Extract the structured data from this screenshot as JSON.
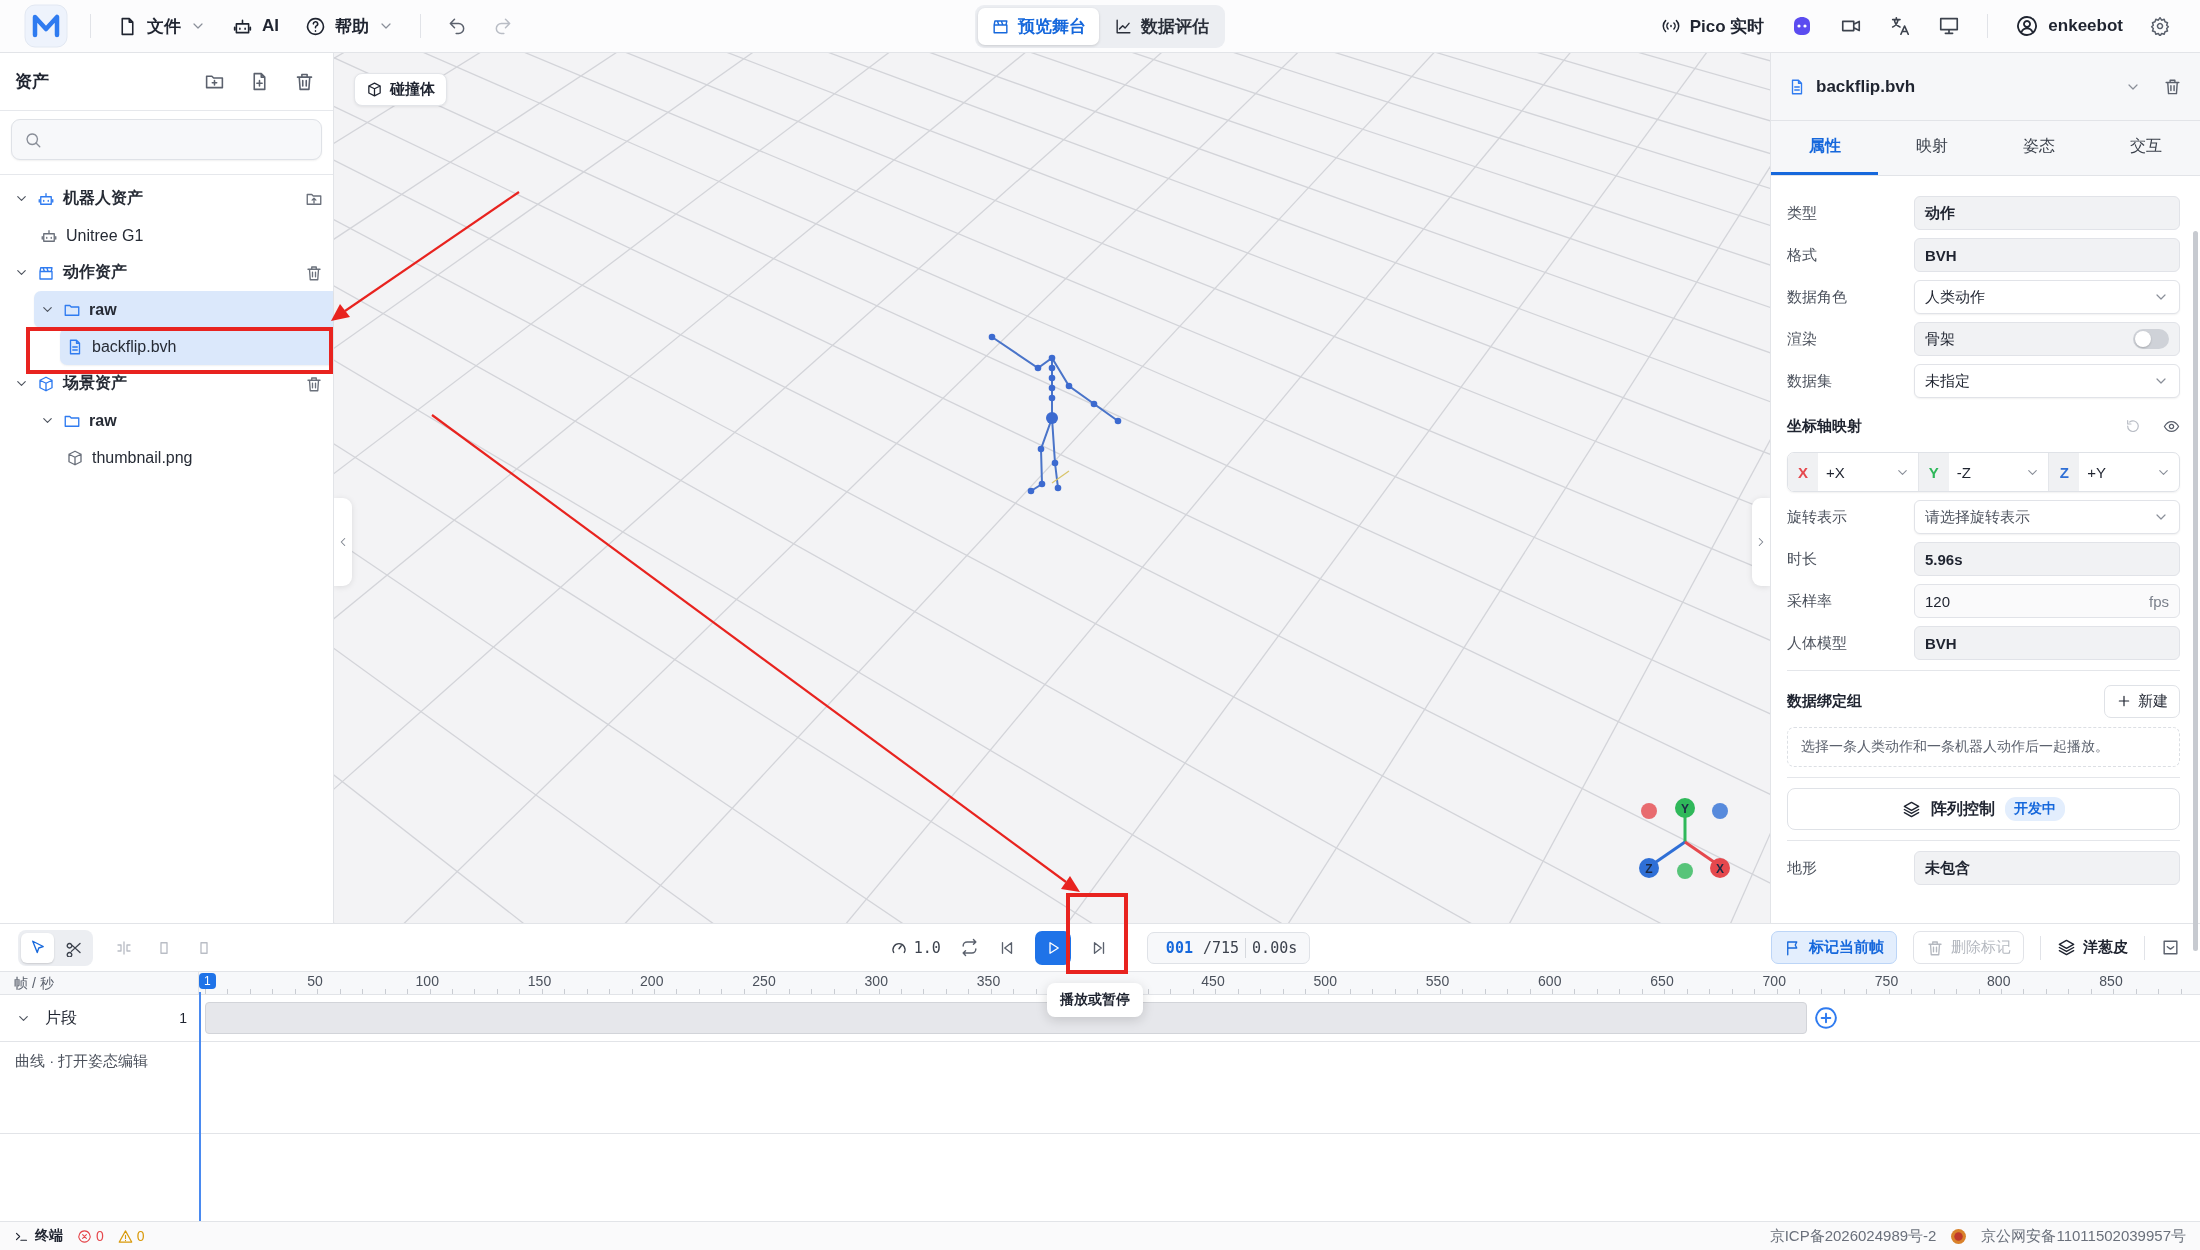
{
  "topbar": {
    "menus": [
      {
        "kind": "file",
        "label": "文件",
        "dropdown": true
      },
      {
        "kind": "ai",
        "label": "AI",
        "dropdown": false
      },
      {
        "kind": "help",
        "label": "帮助",
        "dropdown": true
      }
    ],
    "mode_tabs": [
      {
        "kind": "stage",
        "label": "预览舞台",
        "selected": true
      },
      {
        "kind": "eval",
        "label": "数据评估",
        "selected": false
      }
    ],
    "live": "Pico 实时",
    "user": "enkeebot"
  },
  "assets": {
    "title": "资产",
    "tree": [
      {
        "kind": "robots",
        "label": "机器人资产",
        "expanded": true,
        "selected": false,
        "children": [
          {
            "kind": "robot",
            "label": "Unitree G1",
            "selected": false
          }
        ]
      },
      {
        "kind": "motions",
        "label": "动作资产",
        "expanded": true,
        "selected": false,
        "children": [
          {
            "kind": "folder",
            "label": "raw",
            "expanded": true,
            "selected": true,
            "children": [
              {
                "kind": "file",
                "label": "backflip.bvh",
                "selected": true
              }
            ]
          }
        ]
      },
      {
        "kind": "scenes",
        "label": "场景资产",
        "expanded": true,
        "selected": false,
        "children": [
          {
            "kind": "folder",
            "label": "raw",
            "expanded": true,
            "selected": false,
            "children": [
              {
                "kind": "model",
                "label": "thumbnail.png",
                "selected": false
              }
            ]
          }
        ]
      }
    ]
  },
  "viewport": {
    "collider_button": "碰撞体",
    "gizmo": [
      {
        "label": "Y",
        "color": "#2fb85a"
      },
      {
        "label": "Z",
        "color": "#2f6fd6"
      },
      {
        "label": "X",
        "color": "#e5484d"
      }
    ]
  },
  "inspector": {
    "title": "backflip.bvh",
    "tabs": [
      {
        "label": "属性",
        "selected": true
      },
      {
        "label": "映射",
        "selected": false
      },
      {
        "label": "姿态",
        "selected": false
      },
      {
        "label": "交互",
        "selected": false
      }
    ],
    "fields": [
      {
        "label": "类型",
        "kind": "readonly",
        "value": "动作"
      },
      {
        "label": "格式",
        "kind": "readonly",
        "value": "BVH"
      },
      {
        "label": "数据角色",
        "kind": "select",
        "value": "人类动作"
      },
      {
        "label": "渲染",
        "kind": "toggle",
        "value": "骨架",
        "on": false
      },
      {
        "label": "数据集",
        "kind": "select",
        "value": "未指定"
      }
    ],
    "axis_mapping": {
      "title": "坐标轴映射",
      "axes": [
        {
          "axis": "X",
          "value": "+X",
          "color": "#e5484d"
        },
        {
          "axis": "Y",
          "value": "-Z",
          "color": "#2fb85a"
        },
        {
          "axis": "Z",
          "value": "+Y",
          "color": "#2f6fd6"
        }
      ]
    },
    "motion_fields": [
      {
        "label": "旋转表示",
        "kind": "select",
        "placeholder": "请选择旋转表示"
      },
      {
        "label": "时长",
        "kind": "readonly",
        "value": "5.96s"
      },
      {
        "label": "采样率",
        "kind": "input",
        "value": "120",
        "unit": "fps"
      },
      {
        "label": "人体模型",
        "kind": "readonly",
        "value": "BVH"
      }
    ],
    "binding_group": {
      "title": "数据绑定组",
      "button": "新建",
      "hint": "选择一条人类动作和一条机器人动作后一起播放。"
    },
    "array_control": {
      "label": "阵列控制",
      "badge": "开发中"
    },
    "scene_fields": [
      {
        "label": "地形",
        "kind": "readonly",
        "value": "未包含"
      }
    ]
  },
  "timeline": {
    "tools": [
      {
        "kind": "select",
        "selected": true
      },
      {
        "kind": "cut",
        "selected": false
      }
    ],
    "speed": "1.0",
    "frame": "001",
    "total": "/715",
    "time": "0.00s",
    "tooltip": "播放或暂停",
    "mark_button": "标记当前帧",
    "delete_button": {
      "label": "删除标记",
      "disabled": true
    },
    "onion_button": "洋葱皮",
    "ruler": {
      "unit": "帧 / 秒",
      "current": "1",
      "ticks": [
        "50",
        "100",
        "150",
        "200",
        "250",
        "300",
        "350",
        "450",
        "500",
        "550",
        "600",
        "650",
        "700",
        "750",
        "800",
        "850"
      ]
    },
    "tracks": [
      {
        "label": "片段",
        "count": "1",
        "expanded": true
      }
    ],
    "curve_row": "曲线 · 打开姿态编辑"
  },
  "status_bar": {
    "terminal": "终端",
    "errors": "0",
    "warnings": "0",
    "icp": "京ICP备2026024989号-2",
    "police": "京公网安备11011502039957号"
  }
}
